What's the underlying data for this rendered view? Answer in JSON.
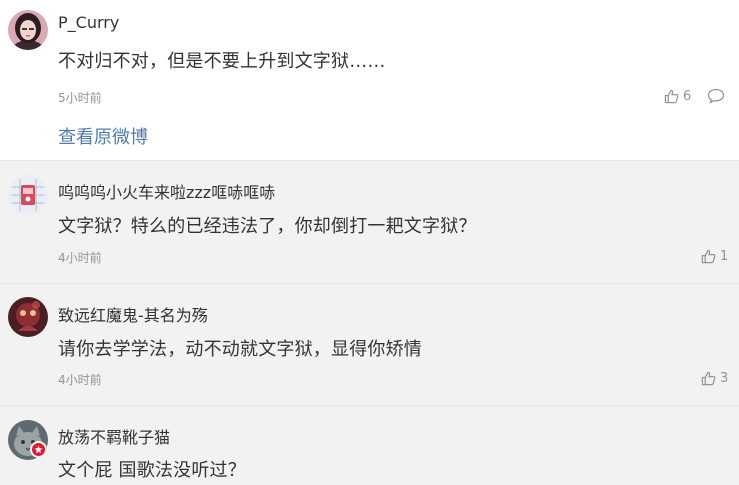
{
  "main_comment": {
    "username": "P_Curry",
    "text": "不对归不对，但是不要上升到文字狱……",
    "time": "5小时前",
    "likes": "6",
    "view_original": "查看原微博"
  },
  "replies": [
    {
      "username": "呜呜呜小火车来啦zzz哐哧哐哧",
      "text": "文字狱？特么的已经违法了，你却倒打一耙文字狱？",
      "time": "4小时前",
      "likes": "1"
    },
    {
      "username": "致远红魔鬼-其名为殇",
      "text": "请你去学学法，动不动就文字狱，显得你矫情",
      "time": "4小时前",
      "likes": "3"
    },
    {
      "username": "放荡不羁靴子猫",
      "text": "文个屁 国歌法没听过？",
      "time": "",
      "likes": ""
    }
  ],
  "colors": {
    "link": "#507daf",
    "meta": "#939393",
    "reply_bg": "#f2f2f2",
    "badge": "#e6162d"
  },
  "icons": {
    "like": "thumbs-up-icon",
    "comment": "comment-bubble-icon",
    "verified": "verified-badge-icon"
  }
}
